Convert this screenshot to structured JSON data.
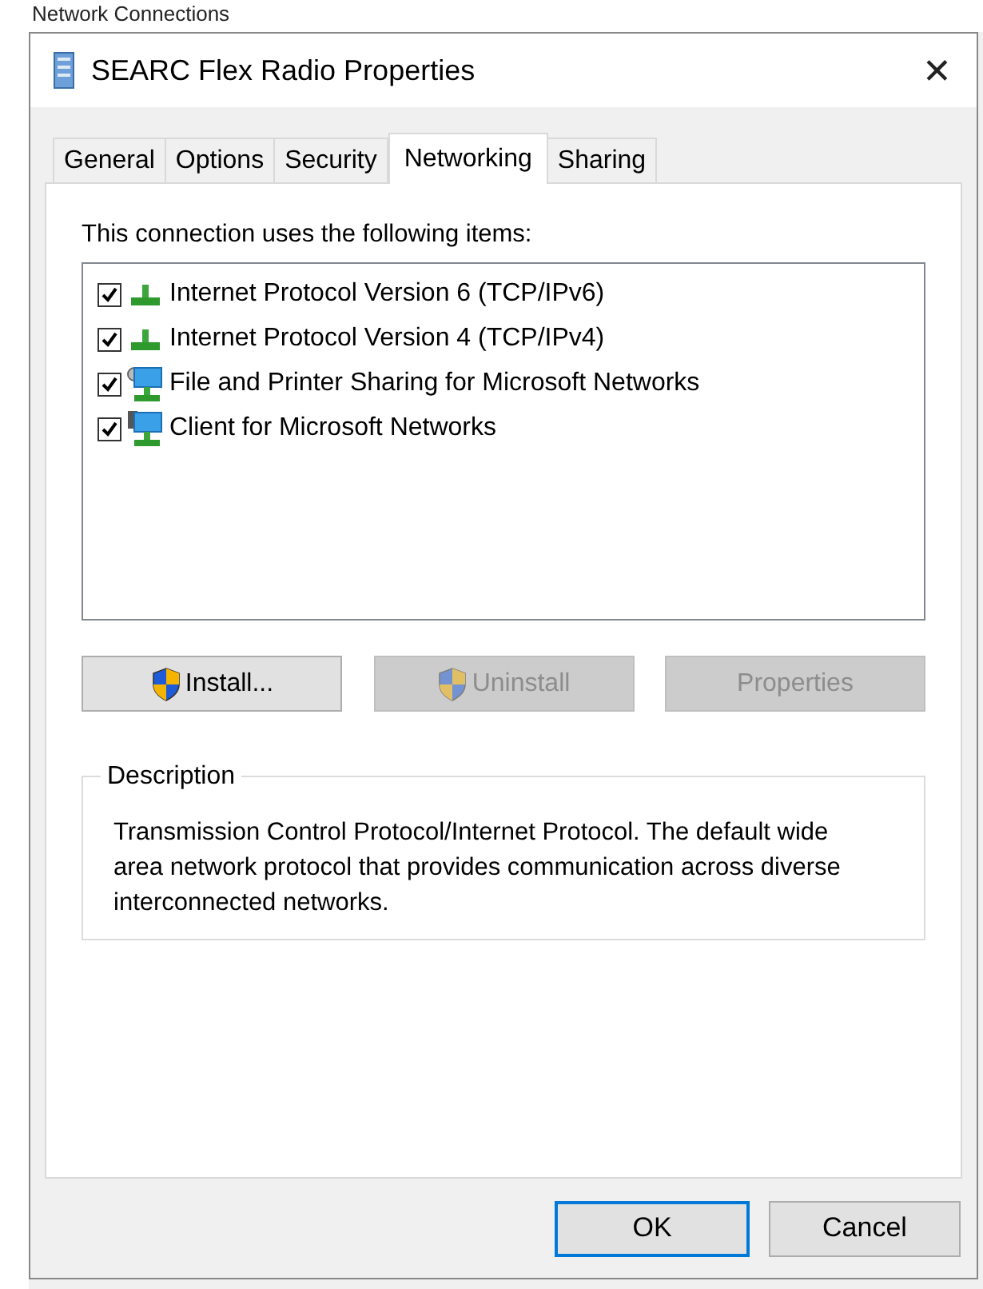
{
  "background_window": {
    "title": "Network Connections"
  },
  "window": {
    "title": "SEARC Flex Radio Properties",
    "close": "✕"
  },
  "tabs": [
    {
      "label": "General",
      "selected": false
    },
    {
      "label": "Options",
      "selected": false
    },
    {
      "label": "Security",
      "selected": false
    },
    {
      "label": "Networking",
      "selected": true
    },
    {
      "label": "Sharing",
      "selected": false
    }
  ],
  "items_label": "This connection uses the following items:",
  "items": [
    {
      "label": "Internet Protocol Version 6 (TCP/IPv6)",
      "checked": true,
      "kind": "protocol"
    },
    {
      "label": "Internet Protocol Version 4 (TCP/IPv4)",
      "checked": true,
      "kind": "protocol"
    },
    {
      "label": "File and Printer Sharing for Microsoft Networks",
      "checked": true,
      "kind": "service"
    },
    {
      "label": "Client for Microsoft Networks",
      "checked": true,
      "kind": "client"
    }
  ],
  "item_buttons": [
    {
      "label": "Install...",
      "disabled": false,
      "shield": true
    },
    {
      "label": "Uninstall",
      "disabled": true,
      "shield": true
    },
    {
      "label": "Properties",
      "disabled": true,
      "shield": false
    }
  ],
  "description": {
    "title": "Description",
    "text": "Transmission Control Protocol/Internet Protocol. The default wide area network protocol that provides communication across diverse interconnected networks."
  },
  "dialog_buttons": [
    {
      "label": "OK",
      "default": true
    },
    {
      "label": "Cancel",
      "default": false
    }
  ]
}
